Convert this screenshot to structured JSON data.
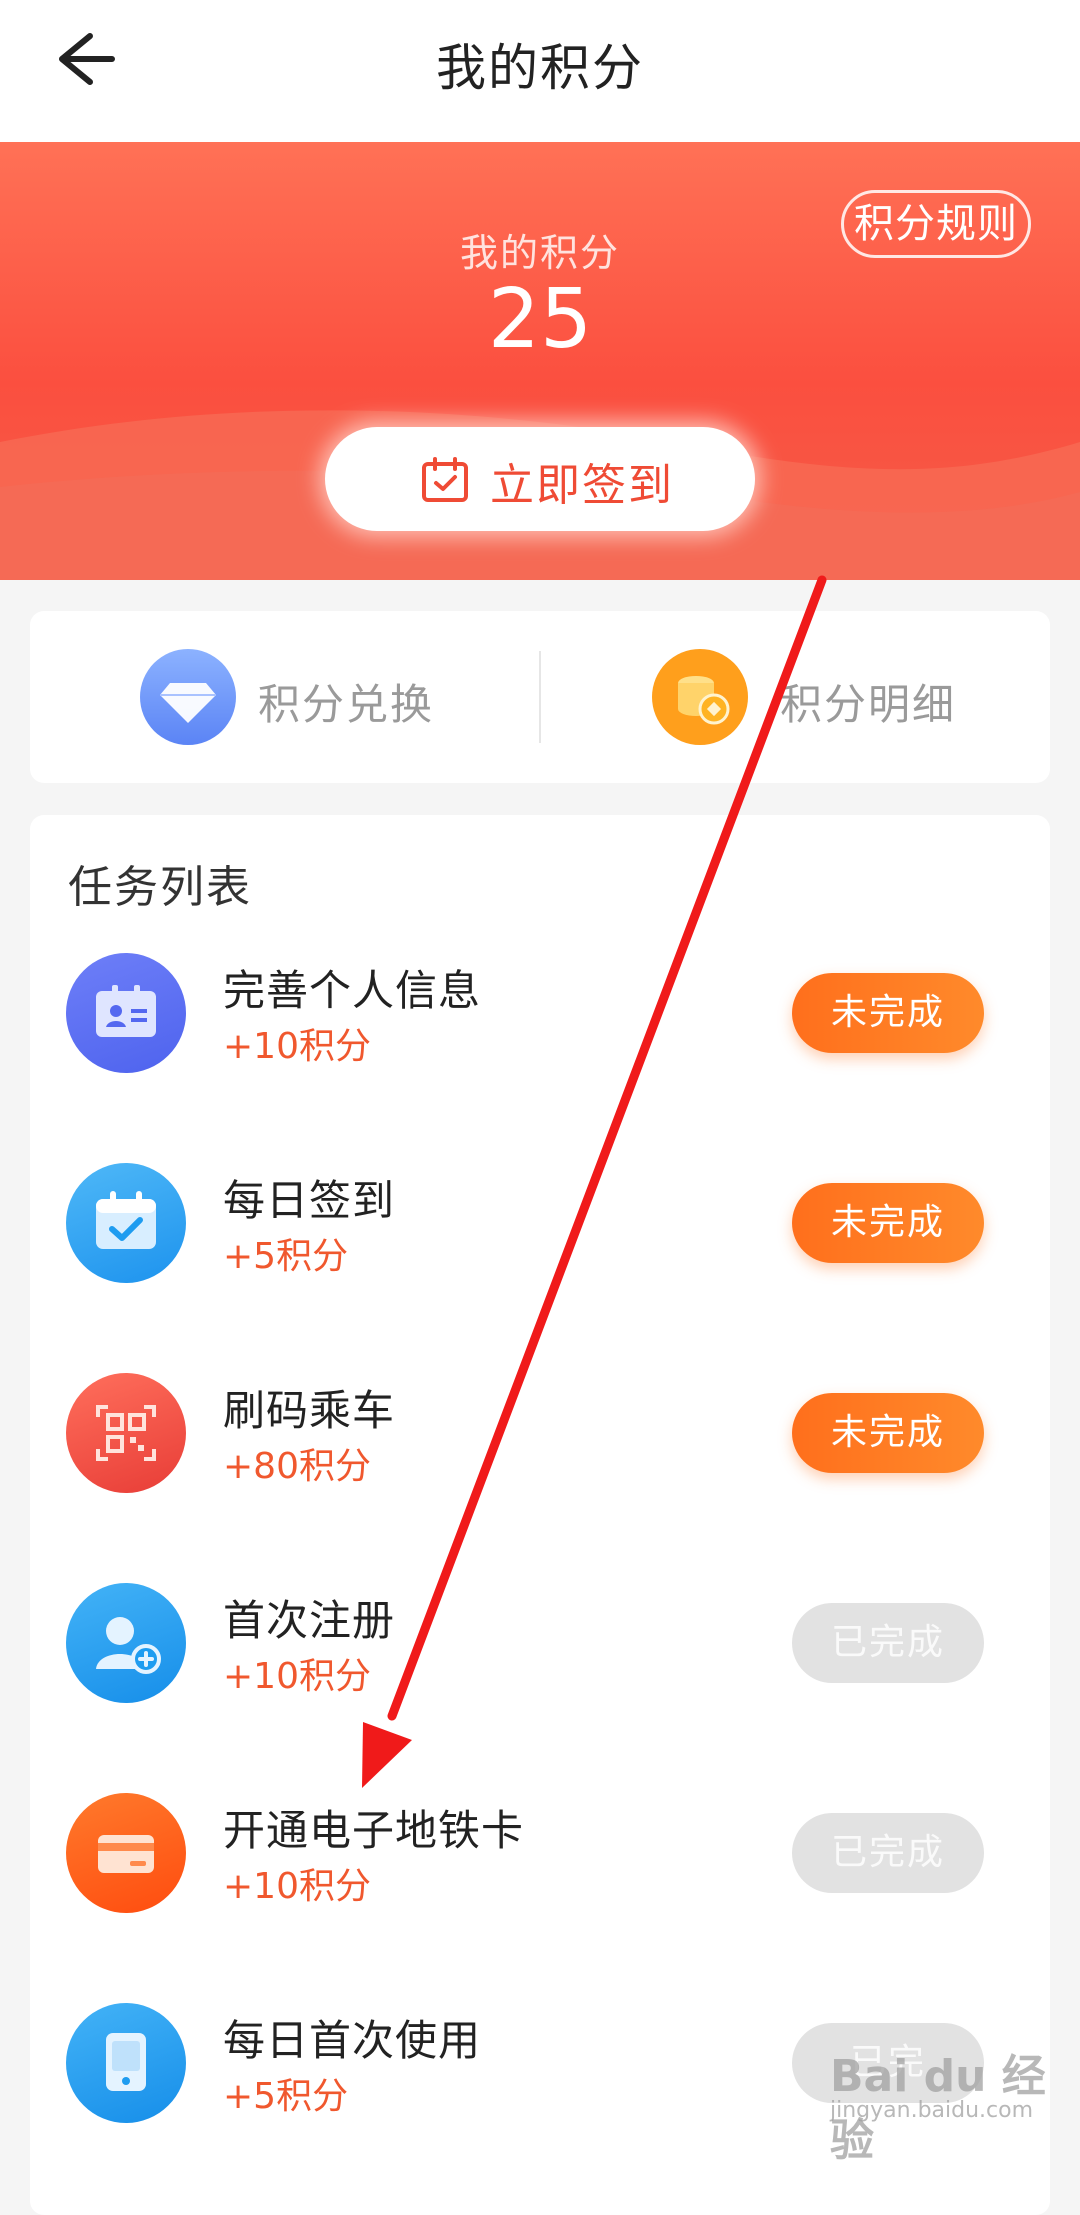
{
  "topbar": {
    "title": "我的积分",
    "back_icon": "arrow-left-icon"
  },
  "hero": {
    "label": "我的积分",
    "points": "25",
    "rules_label": "积分规则",
    "checkin_label": "立即签到",
    "checkin_icon": "calendar-check-icon",
    "colors": {
      "top": "#ff7156",
      "bottom": "#fb4f3f"
    }
  },
  "quick_links": [
    {
      "label": "积分兑换",
      "icon": "diamond-icon"
    },
    {
      "label": "积分明细",
      "icon": "coins-icon"
    }
  ],
  "tasks": {
    "title": "任务列表",
    "items": [
      {
        "name": "完善个人信息",
        "points": "+10积分",
        "status": "未完成",
        "done": false,
        "icon": "id-card-icon",
        "color": "#5468f0"
      },
      {
        "name": "每日签到",
        "points": "+5积分",
        "status": "未完成",
        "done": false,
        "icon": "calendar-check-icon",
        "color": "#2aa1f2"
      },
      {
        "name": "刷码乘车",
        "points": "+80积分",
        "status": "未完成",
        "done": false,
        "icon": "qr-code-icon",
        "color": "#f04a3e"
      },
      {
        "name": "首次注册",
        "points": "+10积分",
        "status": "已完成",
        "done": true,
        "icon": "user-add-icon",
        "color": "#1e9cf0"
      },
      {
        "name": "开通电子地铁卡",
        "points": "+10积分",
        "status": "已完成",
        "done": true,
        "icon": "card-icon",
        "color": "#ff5a14"
      },
      {
        "name": "每日首次使用",
        "points": "+5积分",
        "status": "已完",
        "done": true,
        "icon": "phone-icon",
        "color": "#1e9cf0"
      }
    ]
  },
  "watermark": {
    "main": "Bai du 经验",
    "sub": "jingyan.baidu.com"
  }
}
